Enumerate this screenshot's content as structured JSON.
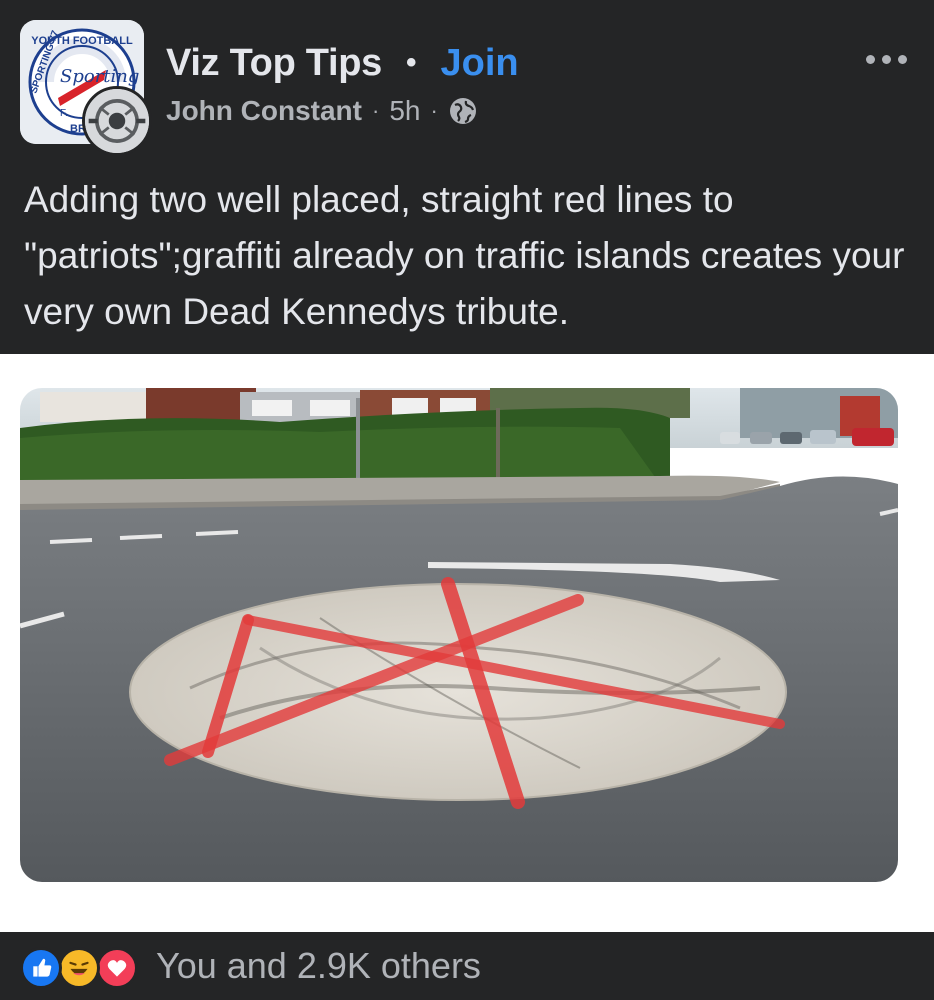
{
  "header": {
    "group_name": "Viz Top Tips",
    "separator": "•",
    "join_label": "Join",
    "author": "John Constant",
    "meta_sep1": "·",
    "time": "5h",
    "meta_sep2": "·",
    "privacy_icon": "globe-icon",
    "more_icon": "more-options-icon"
  },
  "group_logo": {
    "text_top": "YOUTH FOOTBALL",
    "text_left": "SPORTING 77",
    "text_bottom": "BRAIN",
    "script": "Sporting",
    "letters": "F."
  },
  "post": {
    "text": "Adding two well placed, straight red lines to \"patriots\";graffiti already on traffic islands creates your very own Dead Kennedys tribute."
  },
  "reactions": {
    "icons": [
      "like-icon",
      "haha-icon",
      "love-icon"
    ],
    "summary": "You and 2.9K others"
  },
  "colors": {
    "background": "#242526",
    "accent": "#3a8fef",
    "text_primary": "#e4e6eb",
    "text_secondary": "#b0b3b8"
  }
}
